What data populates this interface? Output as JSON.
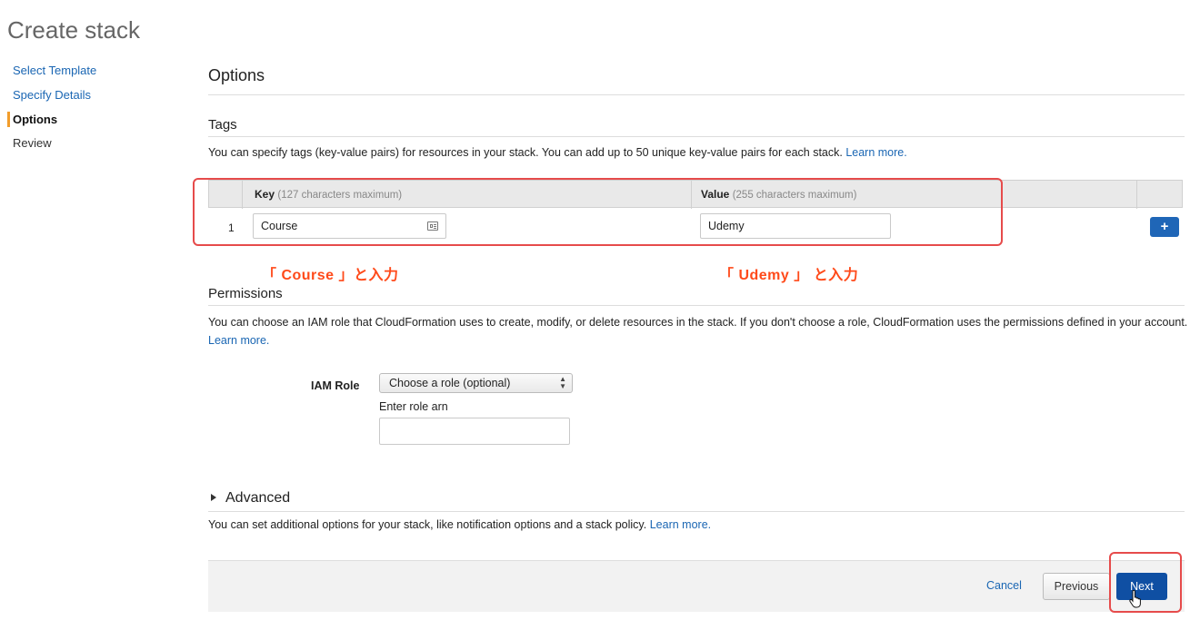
{
  "page": {
    "title": "Create stack"
  },
  "nav": {
    "items": [
      {
        "label": "Select Template",
        "state": "link"
      },
      {
        "label": "Specify Details",
        "state": "link"
      },
      {
        "label": "Options",
        "state": "active"
      },
      {
        "label": "Review",
        "state": "plain"
      }
    ]
  },
  "options": {
    "title": "Options"
  },
  "tags": {
    "title": "Tags",
    "description": "You can specify tags (key-value pairs) for resources in your stack. You can add up to 50 unique key-value pairs for each stack.",
    "learn_more": "Learn more.",
    "key_header": "Key",
    "key_hint": "(127 characters maximum)",
    "value_header": "Value",
    "value_hint": "(255 characters maximum)",
    "rows": [
      {
        "index": "1",
        "key": "Course",
        "value": "Udemy"
      }
    ],
    "add_button": "+"
  },
  "annotations": {
    "course_note": "「 Course 」と入力",
    "udemy_note": "「 Udemy 」 と入力"
  },
  "permissions": {
    "title": "Permissions",
    "description": "You can choose an IAM role that CloudFormation uses to create, modify, or delete resources in the stack. If you don't choose a role, CloudFormation uses the permissions defined in your account.",
    "learn_more": "Learn more.",
    "iam_label": "IAM Role",
    "select_value": "Choose a role (optional)",
    "role_arn_label": "Enter role arn",
    "role_arn_value": ""
  },
  "advanced": {
    "title": "Advanced",
    "description": "You can set additional options for your stack, like notification options and a stack policy.",
    "learn_more": "Learn more."
  },
  "footer": {
    "cancel": "Cancel",
    "previous": "Previous",
    "next": "Next"
  },
  "colors": {
    "link": "#1a66b3",
    "accent": "#f29d2b",
    "primary": "#0f4fa3",
    "annotation": "#ff4a1a",
    "highlight_box": "#e64b4b"
  }
}
